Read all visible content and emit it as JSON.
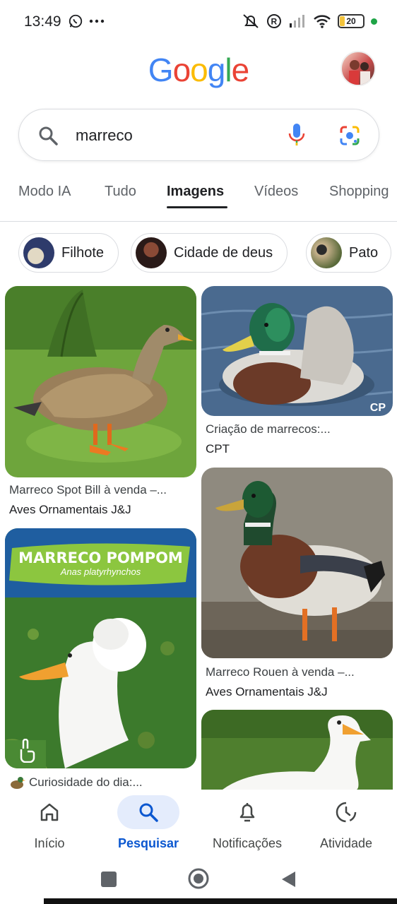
{
  "status_bar": {
    "time": "13:49",
    "battery": "20"
  },
  "brand": {
    "logo_letters": [
      {
        "ch": "G",
        "color": "#4285F4"
      },
      {
        "ch": "o",
        "color": "#EA4335"
      },
      {
        "ch": "o",
        "color": "#FBBC05"
      },
      {
        "ch": "g",
        "color": "#4285F4"
      },
      {
        "ch": "l",
        "color": "#34A853"
      },
      {
        "ch": "e",
        "color": "#EA4335"
      }
    ]
  },
  "search": {
    "query": "marreco"
  },
  "tabs": [
    "Modo IA",
    "Tudo",
    "Imagens",
    "Vídeos",
    "Shopping"
  ],
  "active_tab": "Imagens",
  "chips": [
    "Filhote",
    "Cidade de deus",
    "Pato"
  ],
  "results": {
    "left": [
      {
        "title": "Marreco Spot Bill à venda –...",
        "source": "Aves Ornamentais J&J"
      },
      {
        "banner_title": "MARRECO POMPOM",
        "banner_subtitle": "Anas platyrhynchos",
        "title": "Curiosidade do dia:..."
      }
    ],
    "right": [
      {
        "title": "Criação de marrecos:...",
        "source": "CPT",
        "watermark": "CP"
      },
      {
        "title": "Marreco Rouen à venda –...",
        "source": "Aves Ornamentais J&J"
      }
    ]
  },
  "bottom_nav": [
    {
      "label": "Início",
      "icon": "home-icon"
    },
    {
      "label": "Pesquisar",
      "icon": "search-icon"
    },
    {
      "label": "Notificações",
      "icon": "bell-icon"
    },
    {
      "label": "Atividade",
      "icon": "activity-icon"
    }
  ],
  "colors": {
    "accent": "#0b57d0",
    "active_pill": "#e4ecfc"
  }
}
